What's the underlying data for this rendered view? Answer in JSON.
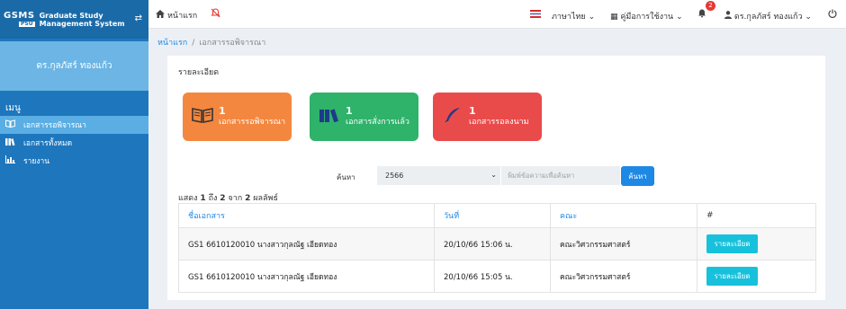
{
  "brand": {
    "logo_main": "GSMS",
    "logo_sub": "PSU",
    "line1": "Graduate Study",
    "line2": "Management System",
    "toggle_icon": "⇄"
  },
  "sidebar": {
    "user_name": "ดร.กุลภัสร์ ทองแก้ว",
    "menu_header": "เมนู",
    "items": [
      {
        "label": "เอกสารรอพิจารณา",
        "icon": "book-open-icon",
        "glyph": "📖"
      },
      {
        "label": "เอกสารทั้งหมด",
        "icon": "books-icon",
        "glyph": "▥"
      },
      {
        "label": "รายงาน",
        "icon": "chart-icon",
        "glyph": "▤"
      }
    ]
  },
  "topbar": {
    "home_label": "หน้าแรก",
    "language": "ภาษาไทย",
    "manual": "คู่มือการใช้งาน",
    "notification_count": "2",
    "user_name": "ดร.กุลภัสร์ ทองแก้ว"
  },
  "breadcrumb": {
    "home": "หน้าแรก",
    "current": "เอกสารรอพิจารณา"
  },
  "card": {
    "title": "รายละเอียด",
    "stats": [
      {
        "count": "1",
        "label": "เอกสารรอพิจารณา",
        "color": "#f4873f",
        "icon": "book-open-icon",
        "glyph": "📖"
      },
      {
        "count": "1",
        "label": "เอกสารสั่งการแล้ว",
        "color": "#2fb26a",
        "icon": "books-icon",
        "glyph": "▥"
      },
      {
        "count": "1",
        "label": "เอกสารรอลงนาม",
        "color": "#e94b4b",
        "icon": "quill-icon",
        "glyph": "✒"
      }
    ],
    "search": {
      "label": "ค้นหา",
      "year": "2566",
      "placeholder": "พิมพ์ข้อความเพื่อค้นหา",
      "button": "ค้นหา"
    },
    "showing": {
      "prefix": "แสดง",
      "from": "1",
      "to_word": "ถึง",
      "to": "2",
      "of_word": "จาก",
      "total": "2",
      "suffix": "ผลลัพธ์"
    },
    "table": {
      "headers": [
        "ชื่อเอกสาร",
        "วันที่",
        "คณะ",
        "#"
      ],
      "rows": [
        {
          "name": "GS1 6610120010 นางสาวกุลณัฐ เอียดทอง",
          "date": "20/10/66 15:06 น.",
          "faculty": "คณะวิศวกรรมศาสตร์",
          "action": "รายละเอียด"
        },
        {
          "name": "GS1 6610120010 นางสาวกุลณัฐ เอียดทอง",
          "date": "20/10/66 15:05 น.",
          "faculty": "คณะวิศวกรรมศาสตร์",
          "action": "รายละเอียด"
        }
      ]
    }
  }
}
